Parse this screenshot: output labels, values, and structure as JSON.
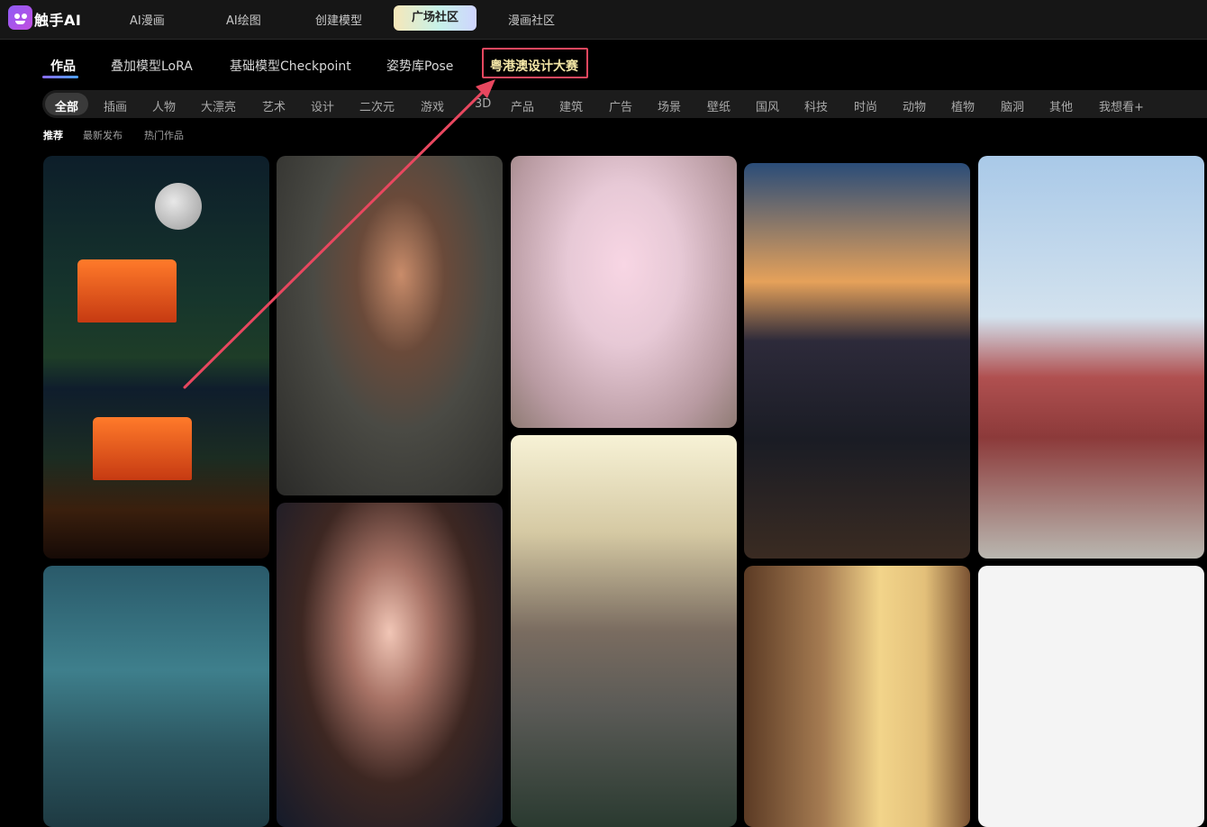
{
  "brand": {
    "name": "触手AI"
  },
  "topnav": {
    "items": [
      "AI漫画",
      "AI绘图",
      "创建模型",
      "广场社区",
      "漫画社区"
    ],
    "active": "广场社区"
  },
  "subtabs": {
    "items": [
      "作品",
      "叠加模型LoRA",
      "基础模型Checkpoint",
      "姿势库Pose",
      "粤港澳设计大赛"
    ],
    "active": "作品"
  },
  "categories": {
    "items": [
      "全部",
      "插画",
      "人物",
      "大漂亮",
      "艺术",
      "设计",
      "二次元",
      "游戏",
      "3D",
      "产品",
      "建筑",
      "广告",
      "场景",
      "壁纸",
      "国风",
      "科技",
      "时尚",
      "动物",
      "植物",
      "脑洞",
      "其他",
      "我想看+"
    ],
    "active": "全部"
  },
  "sort": {
    "items": [
      "推荐",
      "最新发布",
      "热门作品"
    ],
    "active": "推荐"
  },
  "gallery": {
    "cards": [
      "pavilion-moon",
      "woman-portrait",
      "anime-bunny-girl",
      "city-street-cats",
      "anime-girl-red-jacket",
      "underwater-city",
      "woman-long-hair",
      "fantasy-castle",
      "cozy-library-room",
      "chinese-traditional-woman"
    ]
  },
  "colors": {
    "accent_gradient_start": "#8a6cff",
    "accent_gradient_end": "#4ca2ff",
    "annotation_red": "#e8475f"
  }
}
